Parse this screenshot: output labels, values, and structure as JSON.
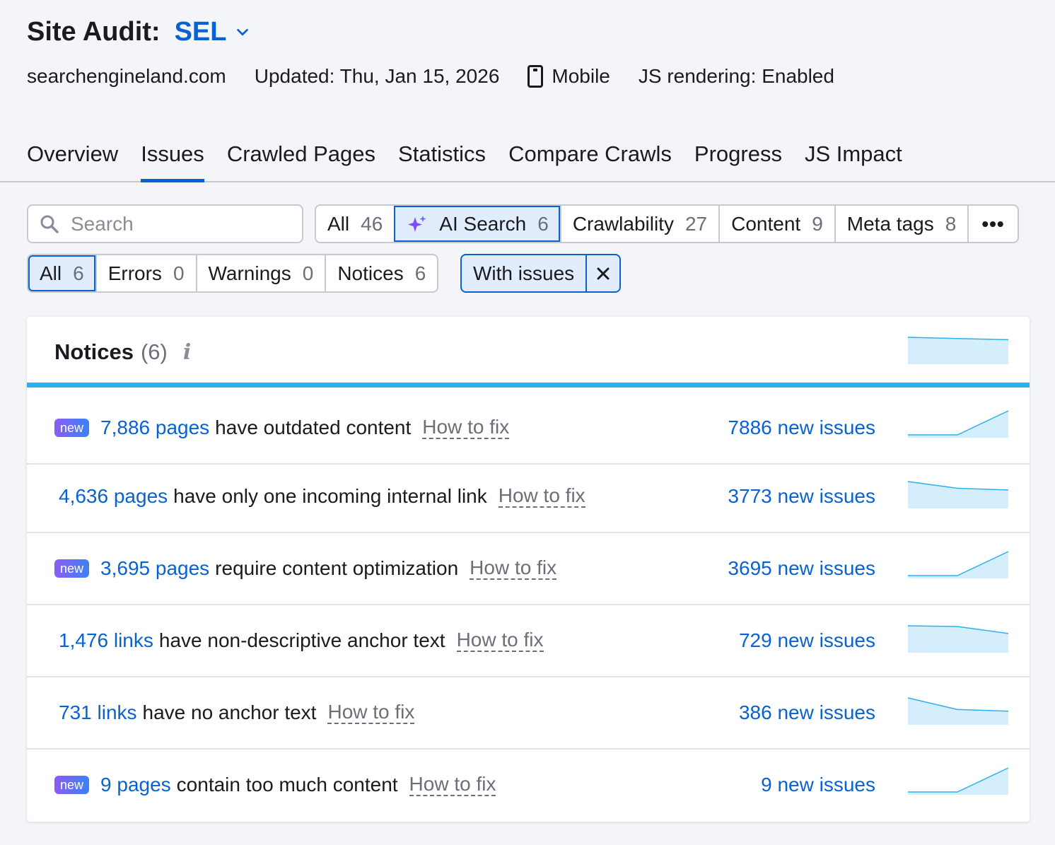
{
  "header": {
    "title": "Site Audit:",
    "project": "SEL",
    "domain": "searchengineland.com",
    "updated": "Updated: Thu, Jan 15, 2026",
    "device": "Mobile",
    "js_rendering": "JS rendering: Enabled"
  },
  "tabs": [
    {
      "label": "Overview",
      "active": false
    },
    {
      "label": "Issues",
      "active": true
    },
    {
      "label": "Crawled Pages",
      "active": false
    },
    {
      "label": "Statistics",
      "active": false
    },
    {
      "label": "Compare Crawls",
      "active": false
    },
    {
      "label": "Progress",
      "active": false
    },
    {
      "label": "JS Impact",
      "active": false
    }
  ],
  "search": {
    "placeholder": "Search",
    "value": ""
  },
  "categories": [
    {
      "label": "All",
      "count": "46"
    },
    {
      "label": "AI Search",
      "count": "6",
      "icon": "sparkle-icon",
      "selected": true
    },
    {
      "label": "Crawlability",
      "count": "27"
    },
    {
      "label": "Content",
      "count": "9"
    },
    {
      "label": "Meta tags",
      "count": "8"
    }
  ],
  "severity": [
    {
      "label": "All",
      "count": "6",
      "selected": true
    },
    {
      "label": "Errors",
      "count": "0"
    },
    {
      "label": "Warnings",
      "count": "0"
    },
    {
      "label": "Notices",
      "count": "6"
    }
  ],
  "filter_chip": {
    "label": "With issues"
  },
  "card": {
    "title": "Notices",
    "count": "(6)",
    "rows": [
      {
        "badge": "new",
        "link": "7,886 pages",
        "text": "have outdated content",
        "fix": "How to fix",
        "new_issues": "7886 new issues",
        "trend": [
          0,
          0,
          1
        ]
      },
      {
        "badge": "",
        "link": "4,636 pages",
        "text": "have only one incoming internal link",
        "fix": "How to fix",
        "new_issues": "3773 new issues",
        "trend": [
          1,
          0.72,
          0.65
        ]
      },
      {
        "badge": "new",
        "link": "3,695 pages",
        "text": "require content optimization",
        "fix": "How to fix",
        "new_issues": "3695 new issues",
        "trend": [
          0,
          0,
          1
        ]
      },
      {
        "badge": "",
        "link": "1,476 links",
        "text": "have non-descriptive anchor text",
        "fix": "How to fix",
        "new_issues": "729 new issues",
        "trend": [
          1,
          0.97,
          0.68
        ]
      },
      {
        "badge": "",
        "link": "731 links",
        "text": "have no anchor text",
        "fix": "How to fix",
        "new_issues": "386 new issues",
        "trend": [
          1,
          0.52,
          0.45
        ]
      },
      {
        "badge": "new",
        "link": "9 pages",
        "text": "contain too much content",
        "fix": "How to fix",
        "new_issues": "9 new issues",
        "trend": [
          0,
          0,
          1
        ]
      }
    ],
    "header_trend": [
      1,
      0.95,
      0.9
    ]
  },
  "colors": {
    "accent": "#0862d1",
    "spark_line": "#2bb0f2",
    "spark_fill": "#d4eefc",
    "badge_from": "#8b5cf6",
    "badge_to": "#3b82f6"
  }
}
